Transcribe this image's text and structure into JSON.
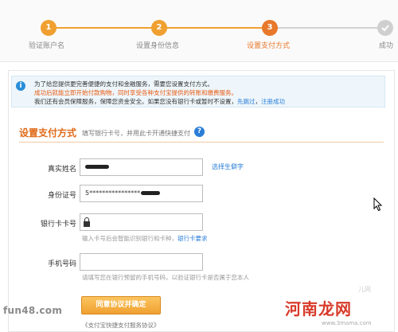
{
  "steps": [
    {
      "number": "1",
      "label": "验证账户名"
    },
    {
      "number": "2",
      "label": "设置身份信息"
    },
    {
      "number": "3",
      "label": "设置支付方式"
    },
    {
      "number": "",
      "label": "成功"
    }
  ],
  "notice": {
    "line1": "为了给您提供更完善便捷的支付和金融服务，需要您设置支付方式。",
    "line2": "成功后就能立即开始付款购物，同时享受各种支付宝提供的转账和缴费服务。",
    "line3_text": "我们还有会员保障服务，保障您资金安全。如果您没有银行卡或暂时不设置，",
    "line3_link1": "先跳过",
    "line3_sep": "，",
    "line3_link2": "注册成功"
  },
  "section": {
    "title": "设置支付方式",
    "hint": "填写银行卡号，并用此卡开通快捷支付",
    "help": "?"
  },
  "form": {
    "name_label": "真实姓名",
    "rare_char_link": "选择生僻字",
    "id_label": "身份证号",
    "id_value": "5****************",
    "card_label": "银行卡卡号",
    "card_note_text": "输入卡号后会智能识别银行和卡种，",
    "card_note_link": "银行卡要求",
    "phone_label": "手机号码",
    "phone_note": "请填写您在银行预留的手机号码，以验证银行卡是否属于您本人",
    "submit_label": "同意协议并确定",
    "agreement": "《支付宝快捷支付服务协议》"
  },
  "watermarks": {
    "left": "fun48.com",
    "right": "河南龙网",
    "ghost": "儿网",
    "url": "www.3mama.com"
  }
}
